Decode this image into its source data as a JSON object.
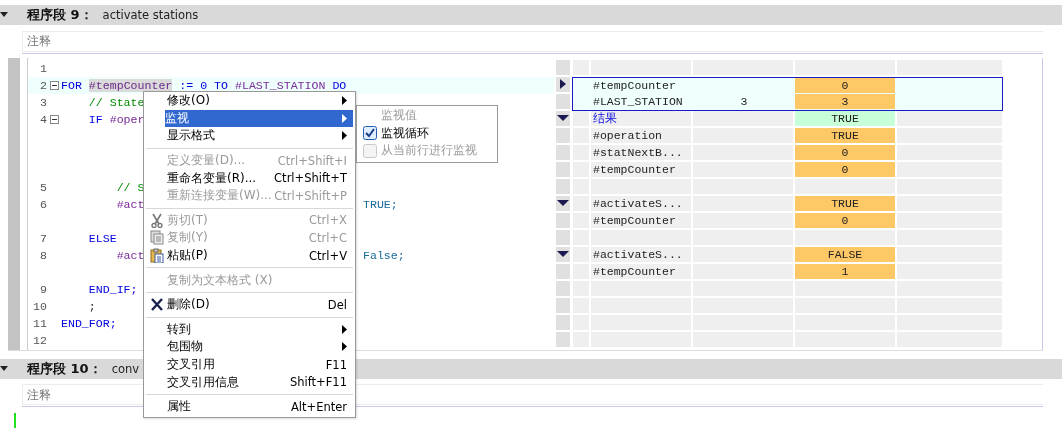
{
  "sections": [
    {
      "title": "程序段 9：",
      "description": "activate stations",
      "comment_placeholder": "注释",
      "editor": {
        "rows": [
          {
            "code": {
              "number": "1",
              "fold": false,
              "current": false
            }
          },
          {
            "code": {
              "number": "2",
              "fold": true,
              "current": true,
              "segments": [
                {
                  "kind": "keyword",
                  "text": "FOR "
                },
                {
                  "kind": "selvar",
                  "text": "#tempCounter"
                },
                {
                  "kind": "keyword",
                  "text": " := 0 TO "
                },
                {
                  "kind": "var",
                  "text": "#LAST_STATION"
                },
                {
                  "kind": "keyword",
                  "text": " DO"
                }
              ]
            },
            "monitor": {
              "group": true,
              "expanded": false,
              "operand": "#tempCounter",
              "value": "0",
              "color": "#ffc866",
              "selected": true
            }
          },
          {
            "code": {
              "number": "3",
              "fold": false,
              "current": false,
              "segments": [
                {
                  "kind": "comment",
                  "text": "    // State"
                }
              ]
            },
            "monitor": {
              "group": false,
              "operand": "#LAST_STATION",
              "column_2": "3",
              "value": "3",
              "color": "#ffc866",
              "selected": true
            }
          },
          {
            "code": {
              "number": "4",
              "fold": true,
              "current": false,
              "segments": [
                {
                  "kind": "keyword",
                  "text": "    IF "
                },
                {
                  "kind": "var",
                  "text": "#oper"
                }
              ]
            },
            "monitor": {
              "group": true,
              "expanded": true,
              "kind": "result",
              "operand": "结果",
              "value": "TRUE",
              "color": "#c6ffd8",
              "selected": false
            }
          },
          {
            "monitor": {
              "group": false,
              "operand": "#operation",
              "value": "TRUE",
              "color": "#ffc866",
              "selected": false
            }
          },
          {
            "monitor": {
              "group": false,
              "operand": "#statNextB...",
              "value": "0",
              "color": "#ffc866",
              "selected": false
            }
          },
          {
            "monitor": {
              "group": false,
              "operand": "#tempCounter",
              "value": "0",
              "color": "#ffc866",
              "selected": false
            }
          },
          {
            "code": {
              "number": "5",
              "fold": false,
              "current": false,
              "segments": [
                {
                  "kind": "comment",
                  "text": "        // S"
                }
              ]
            }
          },
          {
            "code": {
              "number": "6",
              "fold": false,
              "current": false,
              "segments": [
                {
                  "kind": "var",
                  "text": "        #act"
                }
              ],
              "tail": [
                {
                  "kind": "const",
                  "text": "TRUE;"
                }
              ]
            },
            "monitor": {
              "group": true,
              "expanded": true,
              "operand": "#activateS...",
              "value": "TRUE",
              "color": "#ffc866",
              "selected": false
            }
          },
          {
            "monitor": {
              "group": false,
              "operand": "#tempCounter",
              "value": "0",
              "color": "#ffc866",
              "selected": false
            }
          },
          {
            "code": {
              "number": "7",
              "fold": false,
              "current": false,
              "segments": [
                {
                  "kind": "keyword",
                  "text": "    ELSE"
                }
              ]
            }
          },
          {
            "code": {
              "number": "8",
              "fold": false,
              "current": false,
              "segments": [
                {
                  "kind": "var",
                  "text": "        #act"
                }
              ],
              "tail": [
                {
                  "kind": "const",
                  "text": "False;"
                }
              ]
            },
            "monitor": {
              "group": true,
              "expanded": true,
              "operand": "#activateS...",
              "value": "FALSE",
              "color": "#ffc866",
              "selected": false
            }
          },
          {
            "monitor": {
              "group": false,
              "operand": "#tempCounter",
              "value": "1",
              "color": "#ffc866",
              "selected": false
            }
          },
          {
            "code": {
              "number": "9",
              "fold": false,
              "current": false,
              "segments": [
                {
                  "kind": "keyword",
                  "text": "    END_IF;"
                }
              ]
            }
          },
          {
            "code": {
              "number": "10",
              "fold": false,
              "current": false,
              "segments": [
                {
                  "kind": "plain",
                  "text": "    ;"
                }
              ]
            }
          },
          {
            "code": {
              "number": "11",
              "fold": false,
              "current": false,
              "segments": [
                {
                  "kind": "keyword",
                  "text": "END_FOR;"
                }
              ]
            }
          },
          {
            "code": {
              "number": "12",
              "fold": false,
              "current": false
            }
          }
        ]
      }
    },
    {
      "title": "程序段 10：",
      "description": "conv",
      "comment_placeholder": "注释"
    }
  ],
  "context_menu": {
    "items": [
      {
        "kind": "item",
        "label": "修改(O)",
        "submenu": true,
        "selected": false,
        "disabled": false
      },
      {
        "kind": "item",
        "label": "监视",
        "submenu": true,
        "selected": true,
        "disabled": false
      },
      {
        "kind": "item",
        "label": "显示格式",
        "submenu": true,
        "selected": false,
        "disabled": false
      },
      {
        "kind": "separator"
      },
      {
        "kind": "item",
        "label": "定义变量(D)...",
        "shortcut": "Ctrl+Shift+I",
        "selected": false,
        "disabled": true
      },
      {
        "kind": "item",
        "label": "重命名变量(R)...",
        "shortcut": "Ctrl+Shift+T",
        "selected": false,
        "disabled": false
      },
      {
        "kind": "item",
        "label": "重新连接变量(W)...",
        "shortcut": "Ctrl+Shift+P",
        "selected": false,
        "disabled": true
      },
      {
        "kind": "separator"
      },
      {
        "kind": "item",
        "label": "剪切(T)",
        "shortcut": "Ctrl+X",
        "selected": false,
        "disabled": true
      },
      {
        "kind": "item",
        "label": "复制(Y)",
        "shortcut": "Ctrl+C",
        "selected": false,
        "disabled": true
      },
      {
        "kind": "item",
        "label": "粘贴(P)",
        "shortcut": "Ctrl+V",
        "selected": false,
        "disabled": false
      },
      {
        "kind": "separator"
      },
      {
        "kind": "item",
        "label": "复制为文本格式 (X)",
        "selected": false,
        "disabled": true
      },
      {
        "kind": "separator"
      },
      {
        "kind": "item",
        "label": "删除(D)",
        "shortcut": "Del",
        "selected": false,
        "disabled": false
      },
      {
        "kind": "separator"
      },
      {
        "kind": "item",
        "label": "转到",
        "submenu": true,
        "selected": false,
        "disabled": false
      },
      {
        "kind": "item",
        "label": "包围物",
        "submenu": true,
        "selected": false,
        "disabled": false
      },
      {
        "kind": "item",
        "label": "交叉引用",
        "shortcut": "F11",
        "selected": false,
        "disabled": false
      },
      {
        "kind": "item",
        "label": "交叉引用信息",
        "shortcut": "Shift+F11",
        "selected": false,
        "disabled": false
      },
      {
        "kind": "separator"
      },
      {
        "kind": "item",
        "label": "属性",
        "shortcut": "Alt+Enter",
        "selected": false,
        "disabled": false
      }
    ]
  },
  "submenu": {
    "items": [
      {
        "kind": "label",
        "label": "监视值",
        "disabled": true
      },
      {
        "kind": "check",
        "label": "监视循环",
        "checked": true,
        "disabled": false
      },
      {
        "kind": "check",
        "label": "从当前行进行监视",
        "checked": false,
        "disabled": true
      }
    ]
  }
}
